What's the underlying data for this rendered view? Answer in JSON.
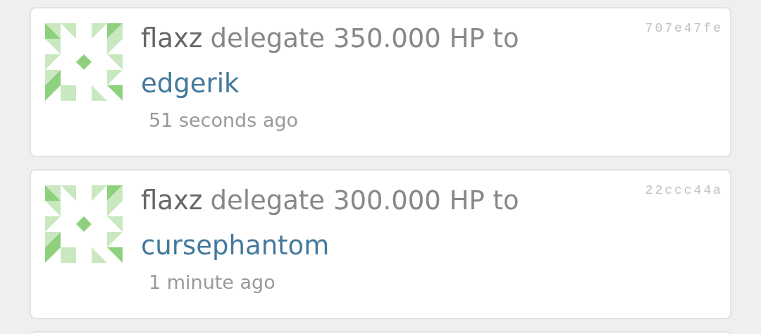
{
  "operations": [
    {
      "account": "flaxz",
      "action": "delegate 350.000 HP to",
      "target": "edgerik",
      "time": "51 seconds ago",
      "hash": "707e47fe"
    },
    {
      "account": "flaxz",
      "action": "delegate 300.000 HP to",
      "target": "cursephantom",
      "time": "1 minute ago",
      "hash": "22ccc44a"
    }
  ]
}
